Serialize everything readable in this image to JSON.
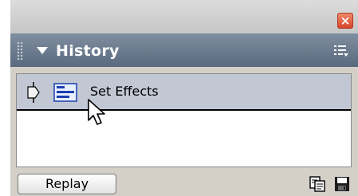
{
  "window": {
    "close_glyph": "×"
  },
  "panel": {
    "title": "History",
    "options_icon": "panel-options-icon",
    "collapse_icon": "triangle-down-icon"
  },
  "history": {
    "items": [
      {
        "label": "Set Effects",
        "icons": [
          "slider-icon",
          "effects-icon"
        ],
        "selected": true
      }
    ]
  },
  "footer": {
    "replay_label": "Replay",
    "copy_icon": "copy-steps-icon",
    "save_icon": "save-as-command-icon"
  },
  "colors": {
    "header": "#6a7a8e",
    "selection": "#c2c7d4",
    "close": "#d8452a"
  }
}
